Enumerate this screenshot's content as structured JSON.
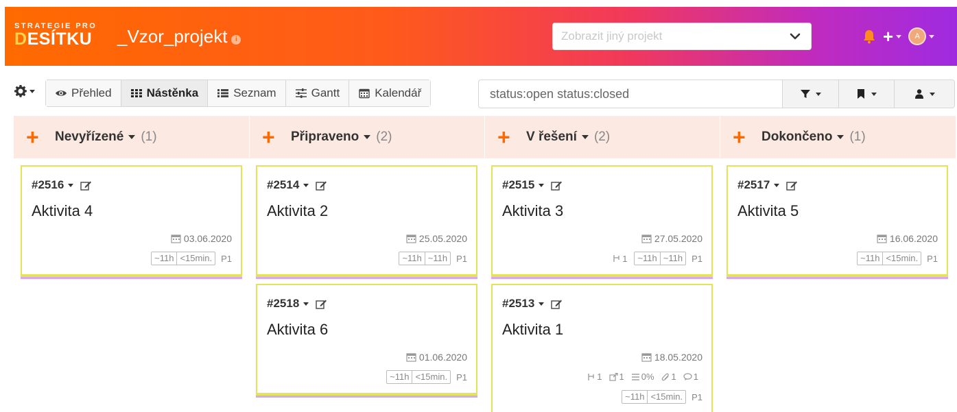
{
  "header": {
    "brand_small": "STRATEGIE PRO",
    "brand_big_accent": "D",
    "brand_big": "ESÍTKU",
    "project_title": "_Vzor_projekt",
    "info_glyph": "i",
    "project_select_placeholder": "Zobrazit jiný projekt",
    "avatar_initial": "A",
    "plus_glyph": "+"
  },
  "toolbar": {
    "views": [
      {
        "label": "Přehled",
        "icon": "eye-icon"
      },
      {
        "label": "Nástěnka",
        "icon": "grid-icon",
        "active": true
      },
      {
        "label": "Seznam",
        "icon": "list-icon"
      },
      {
        "label": "Gantt",
        "icon": "sliders-icon"
      },
      {
        "label": "Kalendář",
        "icon": "calendar-icon"
      }
    ],
    "filter_value": "status:open status:closed"
  },
  "columns": [
    {
      "name": "Nevyřízené",
      "count": "(1)",
      "plus": "+"
    },
    {
      "name": "Připraveno",
      "count": "(2)",
      "plus": "+"
    },
    {
      "name": "V řešení",
      "count": "(2)",
      "plus": "+"
    },
    {
      "name": "Dokončeno",
      "count": "(1)",
      "plus": "+"
    }
  ],
  "cards": [
    {
      "id": "#2516",
      "title": "Aktivita 4",
      "date": "03.06.2020",
      "est1": "~11h",
      "est2": "<15min.",
      "priority": "P1"
    },
    {
      "id": "#2514",
      "title": "Aktivita 2",
      "date": "25.05.2020",
      "est1": "~11h",
      "est2": "~11h",
      "priority": "P1"
    },
    {
      "id": "#2518",
      "title": "Aktivita 6",
      "date": "01.06.2020",
      "est1": "~11h",
      "est2": "<15min.",
      "priority": "P1"
    },
    {
      "id": "#2515",
      "title": "Aktivita 3",
      "date": "27.05.2020",
      "subtasks": "1",
      "est1": "~11h",
      "est2": "~11h",
      "priority": "P1"
    },
    {
      "id": "#2513",
      "title": "Aktivita 1",
      "date": "18.05.2020",
      "subtasks": "1",
      "links": "1",
      "progress": "0%",
      "attachments": "1",
      "comments": "1",
      "est1": "~11h",
      "est2": "<15min.",
      "priority": "P1"
    },
    {
      "id": "#2517",
      "title": "Aktivita 5",
      "date": "16.06.2020",
      "est1": "~11h",
      "est2": "<15min.",
      "priority": "P1"
    }
  ]
}
